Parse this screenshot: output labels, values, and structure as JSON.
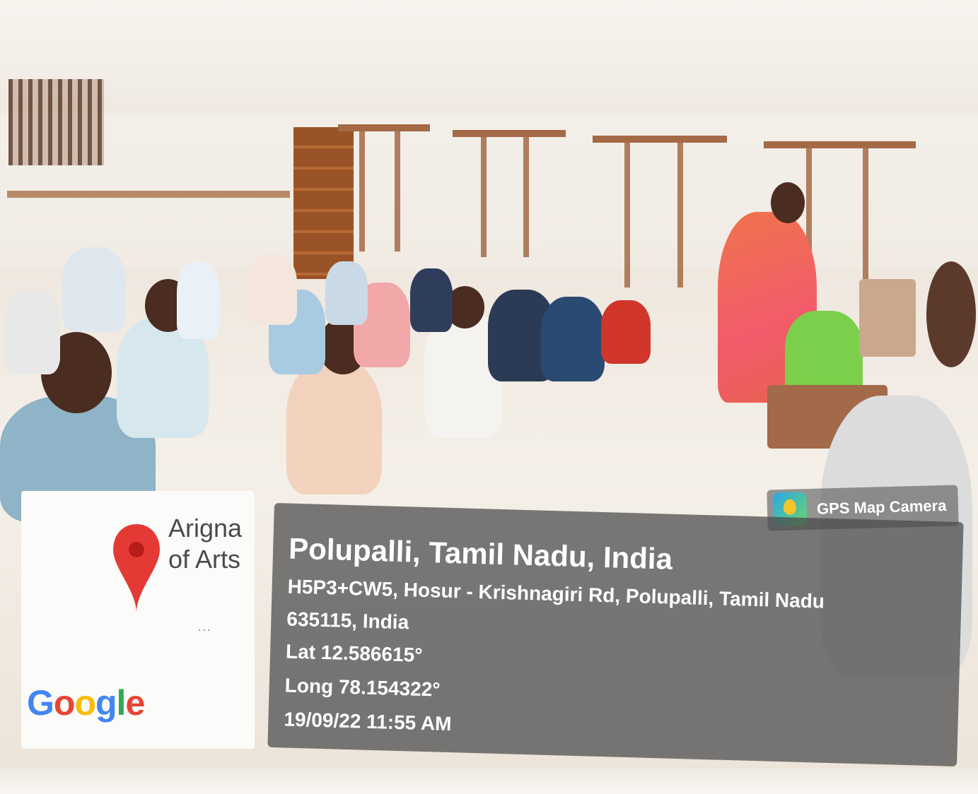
{
  "map_card": {
    "place_short_line1": "Arigna",
    "place_short_line2": "of Arts",
    "more": "...",
    "logo": {
      "letters": [
        "G",
        "o",
        "o",
        "g",
        "l",
        "e"
      ],
      "colors": [
        "#4285F4",
        "#EA4335",
        "#FBBC05",
        "#4285F4",
        "#34A853",
        "#EA4335"
      ]
    },
    "pin_color": "#E53935"
  },
  "gps_badge": {
    "label": "GPS Map Camera",
    "icon": "gps-map-camera-icon"
  },
  "info_panel": {
    "title": "Polupalli, Tamil Nadu, India",
    "address_line1": "H5P3+CW5, Hosur - Krishnagiri Rd, Polupalli, Tamil Nadu",
    "address_line2": "635115, India",
    "latitude": "Lat 12.586615°",
    "longitude": "Long 78.154322°",
    "datetime": "19/09/22 11:55 AM"
  }
}
